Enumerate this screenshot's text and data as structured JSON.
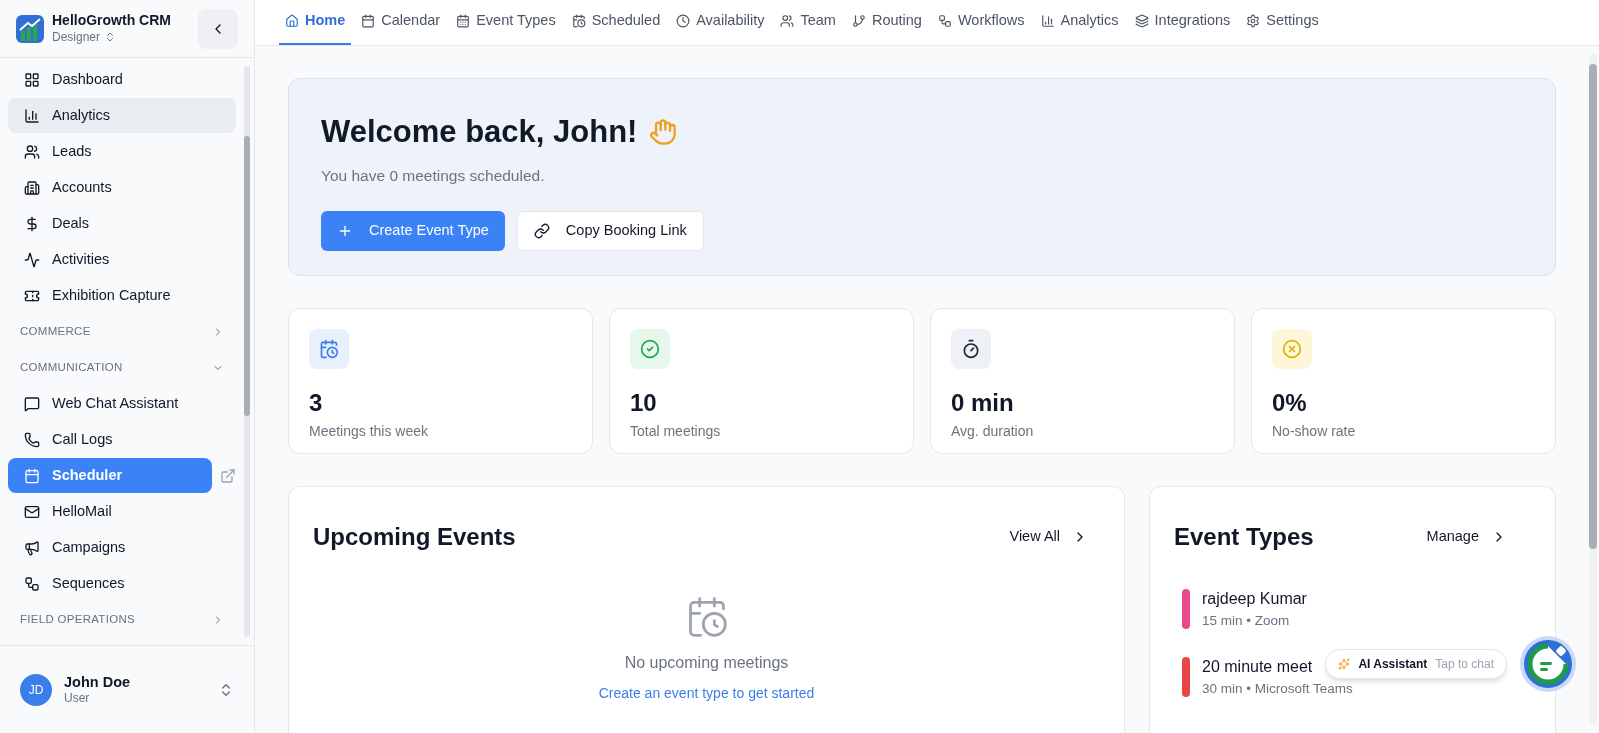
{
  "sidebar": {
    "brand": {
      "name": "HelloGrowth CRM",
      "role": "Designer"
    },
    "nav": [
      {
        "kind": "item",
        "label": "Dashboard",
        "selected": false,
        "hovered": false,
        "external": false
      },
      {
        "kind": "item",
        "label": "Analytics",
        "selected": false,
        "hovered": true,
        "external": false
      },
      {
        "kind": "item",
        "label": "Leads",
        "selected": false,
        "hovered": false,
        "external": false
      },
      {
        "kind": "item",
        "label": "Accounts",
        "selected": false,
        "hovered": false,
        "external": false
      },
      {
        "kind": "item",
        "label": "Deals",
        "selected": false,
        "hovered": false,
        "external": false
      },
      {
        "kind": "item",
        "label": "Activities",
        "selected": false,
        "hovered": false,
        "external": false
      },
      {
        "kind": "item",
        "label": "Exhibition Capture",
        "selected": false,
        "hovered": false,
        "external": false
      },
      {
        "kind": "section",
        "label": "COMMERCE",
        "expanded": false
      },
      {
        "kind": "section",
        "label": "COMMUNICATION",
        "expanded": true
      },
      {
        "kind": "item",
        "label": "Web Chat Assistant",
        "selected": false,
        "hovered": false,
        "external": false
      },
      {
        "kind": "item",
        "label": "Call Logs",
        "selected": false,
        "hovered": false,
        "external": false
      },
      {
        "kind": "item",
        "label": "Scheduler",
        "selected": true,
        "hovered": false,
        "external": true
      },
      {
        "kind": "item",
        "label": "HelloMail",
        "selected": false,
        "hovered": false,
        "external": false
      },
      {
        "kind": "item",
        "label": "Campaigns",
        "selected": false,
        "hovered": false,
        "external": false
      },
      {
        "kind": "item",
        "label": "Sequences",
        "selected": false,
        "hovered": false,
        "external": false
      },
      {
        "kind": "section",
        "label": "FIELD OPERATIONS",
        "expanded": false
      }
    ],
    "user": {
      "initials": "JD",
      "name": "John Doe",
      "role": "User"
    }
  },
  "tabs": [
    {
      "label": "Home",
      "selected": true
    },
    {
      "label": "Calendar",
      "selected": false
    },
    {
      "label": "Event Types",
      "selected": false
    },
    {
      "label": "Scheduled",
      "selected": false
    },
    {
      "label": "Availability",
      "selected": false
    },
    {
      "label": "Team",
      "selected": false
    },
    {
      "label": "Routing",
      "selected": false
    },
    {
      "label": "Workflows",
      "selected": false
    },
    {
      "label": "Analytics",
      "selected": false
    },
    {
      "label": "Integrations",
      "selected": false
    },
    {
      "label": "Settings",
      "selected": false
    }
  ],
  "welcome": {
    "title": "Welcome back, John!",
    "subtitle": "You have 0 meetings scheduled.",
    "primary_button": "Create Event Type",
    "secondary_button": "Copy Booking Link"
  },
  "stats": [
    {
      "value": "3",
      "label": "Meetings this week"
    },
    {
      "value": "10",
      "label": "Total meetings"
    },
    {
      "value": "0 min",
      "label": "Avg. duration"
    },
    {
      "value": "0%",
      "label": "No-show rate"
    }
  ],
  "upcoming": {
    "title": "Upcoming Events",
    "link": "View All",
    "empty_message": "No upcoming meetings",
    "empty_link": "Create an event type to get started"
  },
  "event_types": {
    "title": "Event Types",
    "link": "Manage",
    "items": [
      {
        "name": "rajdeep Kumar",
        "details": "15 min • Zoom",
        "color": "#e84a8f"
      },
      {
        "name": "20 minute meet",
        "details": "30 min • Microsoft Teams",
        "color": "#e64646"
      }
    ]
  },
  "assistant": {
    "label": "AI Assistant",
    "hint": "Tap to chat"
  }
}
